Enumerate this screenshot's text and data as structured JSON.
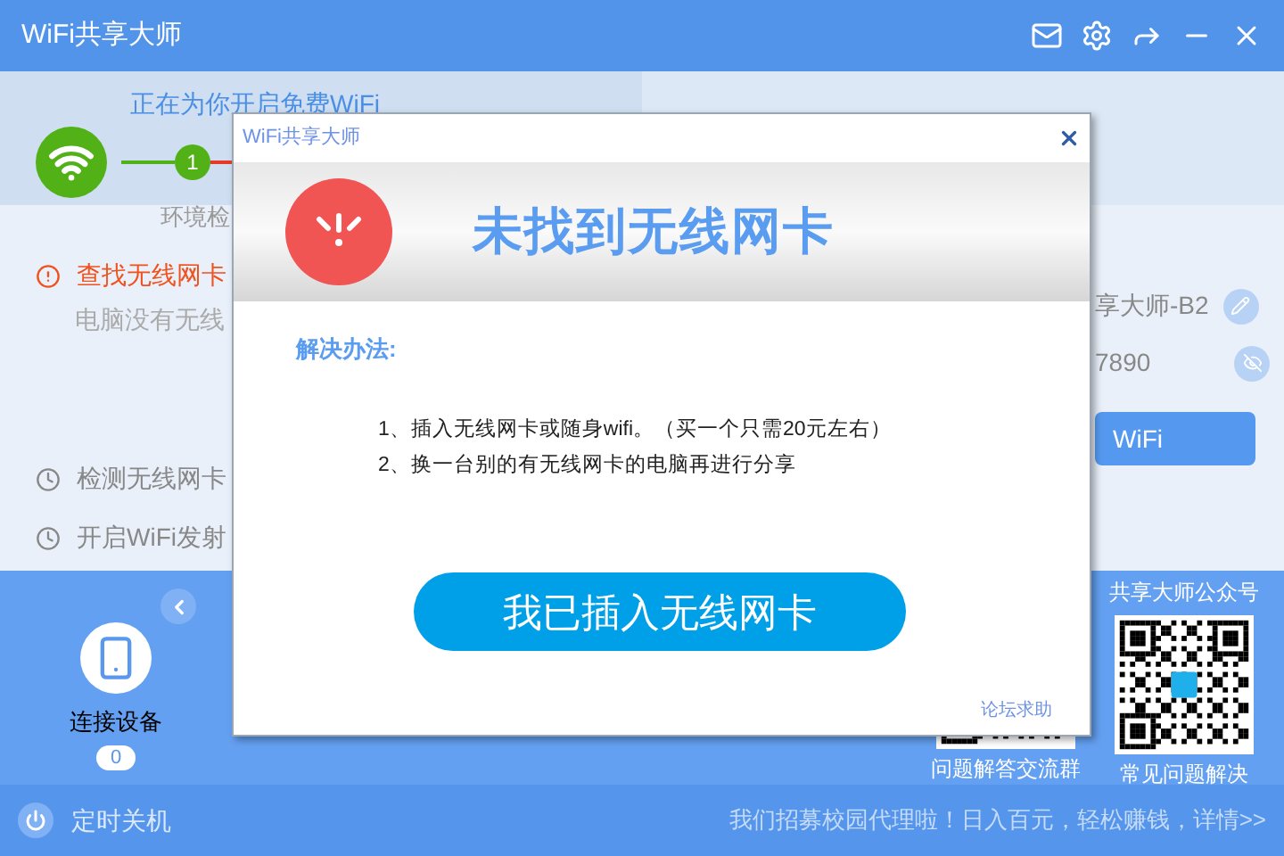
{
  "window": {
    "title": "WiFi共享大师"
  },
  "header": {
    "status": "正在为你开启免费WiFi",
    "step_number": "1",
    "step_label": "环境检"
  },
  "steps": [
    {
      "kind": "error",
      "title": "查找无线网卡",
      "detail": "电脑没有无线"
    },
    {
      "kind": "pending",
      "title": "检测无线网卡"
    },
    {
      "kind": "pending",
      "title": "开启WiFi发射"
    }
  ],
  "wifi_settings": {
    "name": "享大师-B2",
    "password": "7890",
    "button": "WiFi"
  },
  "devices": {
    "label": "连接设备",
    "count": "0"
  },
  "qr_codes": [
    {
      "caption": "问题解答交流群"
    },
    {
      "title": "共享大师公众号",
      "caption": "常见问题解决"
    }
  ],
  "footer": {
    "timer": "定时关机",
    "promo": "我们招募校园代理啦！日入百元，轻松赚钱，详情>>"
  },
  "dialog": {
    "title": "WiFi共享大师",
    "heading": "未找到无线网卡",
    "solution_label": "解决办法:",
    "solutions": [
      "1、插入无线网卡或随身wifi。（买一个只需20元左右）",
      "2、换一台别的有无线网卡的电脑再进行分享"
    ],
    "button": "我已插入无线网卡",
    "help_link": "论坛求助"
  }
}
